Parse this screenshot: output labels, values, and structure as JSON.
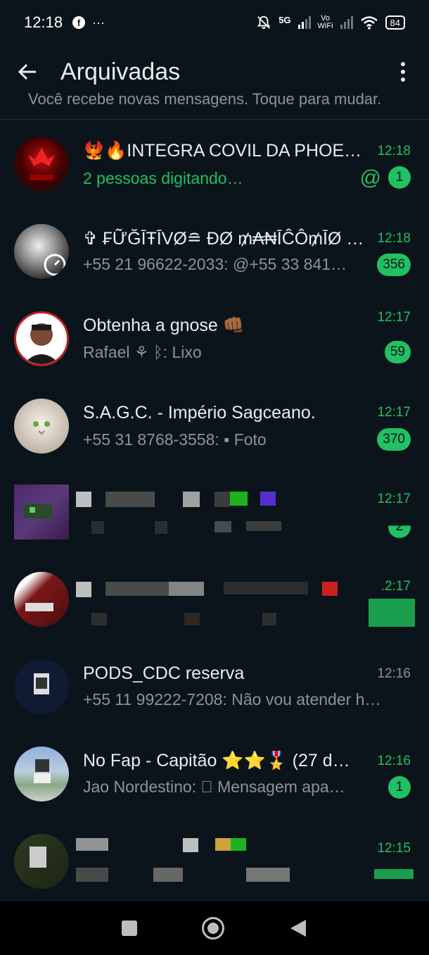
{
  "status_bar": {
    "time": "12:18",
    "network_5g": "5G",
    "volte": "Vo",
    "wifi_calling": "WiFi",
    "battery": "84",
    "more": "···"
  },
  "header": {
    "title": "Arquivadas"
  },
  "notice": "Você recebe novas mensagens. Toque para mudar.",
  "chats": [
    {
      "name": "🐦‍🔥🔥INTEGRA COVIL DA PHOE…",
      "time": "12:18",
      "preview": "2 pessoas digitando…",
      "unread": "1",
      "mention": "@"
    },
    {
      "name": "✞ ₣ỮĞĪŦĪVØ≘ ĐØ ₥₳₦ĪĈÔ₥ĪØ ✞ᶻˣ",
      "time": "12:18",
      "preview": "+55 21 96622-2033: @+55 33 841…",
      "unread": "356"
    },
    {
      "name": "Obtenha a gnose 👊🏾",
      "time": "12:17",
      "preview": "Rafael ⚘ ᛒ: Lixo",
      "unread": "59"
    },
    {
      "name": "S.A.G.C. - Império Sagceano.",
      "time": "12:17",
      "preview": "+55 31 8768-3558: ▪ Foto",
      "unread": "370"
    },
    {
      "name": "",
      "time": "12:17",
      "preview": "",
      "unread": "2"
    },
    {
      "name": "",
      "time": ".2:17",
      "preview": "",
      "unread": ""
    },
    {
      "name": "PODS_CDC reserva",
      "time": "12:16",
      "preview": "+55 11 99222-7208: Não vou atender h…",
      "unread": ""
    },
    {
      "name": "No Fap -  Capitão ⭐⭐🎖️ (27 d…",
      "time": "12:16",
      "preview": "Jao Nordestino: ⃠ Mensagem apa…",
      "unread": "1"
    },
    {
      "name": "",
      "time": "12:15",
      "preview": "",
      "unread": ""
    }
  ],
  "colors": {
    "background": "#0b141a",
    "accent_green": "#21c063",
    "secondary_text": "#8696a0"
  }
}
